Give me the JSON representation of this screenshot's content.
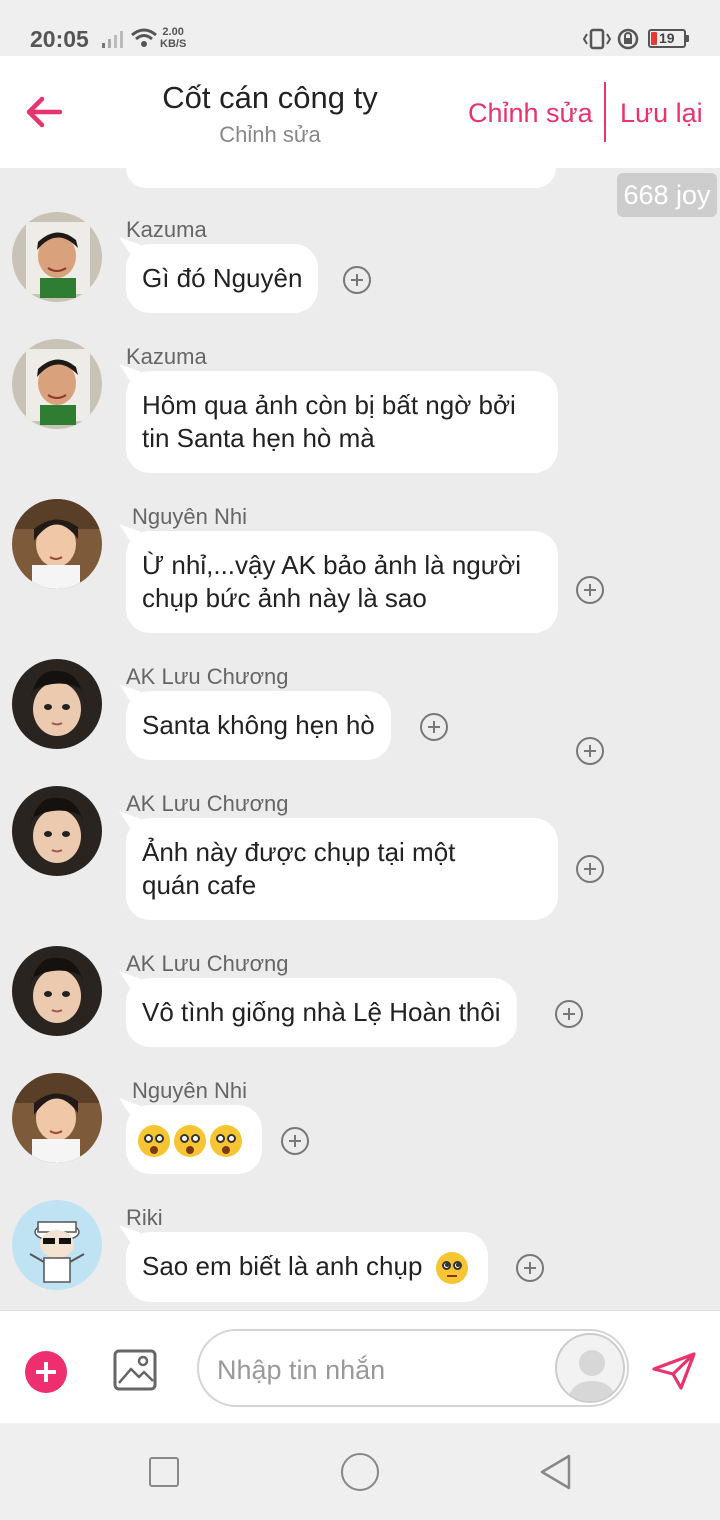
{
  "status_bar": {
    "time": "20:05",
    "net_speed_value": "2.00",
    "net_speed_unit": "KB/S",
    "battery": "19"
  },
  "header": {
    "title": "Cốt cán công ty",
    "subtitle": "Chỉnh sửa",
    "edit_label": "Chỉnh sửa",
    "save_label": "Lưu lại"
  },
  "badge": {
    "text": "668 joy"
  },
  "messages": [
    {
      "sender": "Kazuma",
      "text": "Gì đó Nguyên"
    },
    {
      "sender": "Kazuma",
      "line1": "Hôm qua ảnh còn bị bất ngờ bởi",
      "line2": "tin Santa hẹn hò mà"
    },
    {
      "sender": "Nguyên Nhi",
      "line1": "Ừ nhỉ,...vậy AK bảo ảnh là người",
      "line2": "chụp bức ảnh này là sao"
    },
    {
      "sender": "AK Lưu Chương",
      "text": "Santa không hẹn hò"
    },
    {
      "sender": "AK Lưu Chương",
      "line1": "Ảnh này được chụp tại một",
      "line2": "quán cafe"
    },
    {
      "sender": "AK Lưu Chương",
      "text": "Vô tình giống nhà Lệ Hoàn thôi"
    },
    {
      "sender": "Nguyên Nhi",
      "emojis": [
        "astonished-face",
        "astonished-face",
        "astonished-face"
      ]
    },
    {
      "sender": "Riki",
      "text": "Sao em biết là anh chụp",
      "emoji": "face-with-rolling-eyes"
    }
  ],
  "composer": {
    "placeholder": "Nhập tin nhắn"
  },
  "colors": {
    "accent": "#e8336d",
    "add_button": "#ee2e6e",
    "background": "#ececec",
    "bubble": "#ffffff"
  }
}
